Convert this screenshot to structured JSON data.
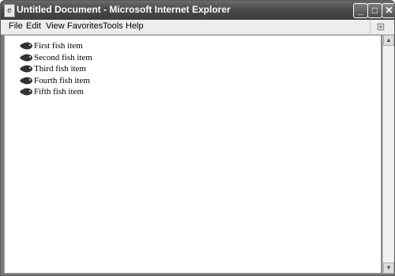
{
  "window": {
    "title": "Untitled Document - Microsoft Internet Explorer"
  },
  "controls": {
    "minimize": "_",
    "maximize": "□",
    "close": "✕"
  },
  "menu": [
    "File",
    "Edit",
    "View",
    "Favorites",
    "Tools",
    "Help"
  ],
  "list_items": [
    "First fish item",
    "Second fish item",
    "Third fish item",
    "Fourth fish item",
    "Fifth fish item"
  ],
  "icons": {
    "bullet": "fish-icon",
    "brand": "windows-flag-icon"
  }
}
